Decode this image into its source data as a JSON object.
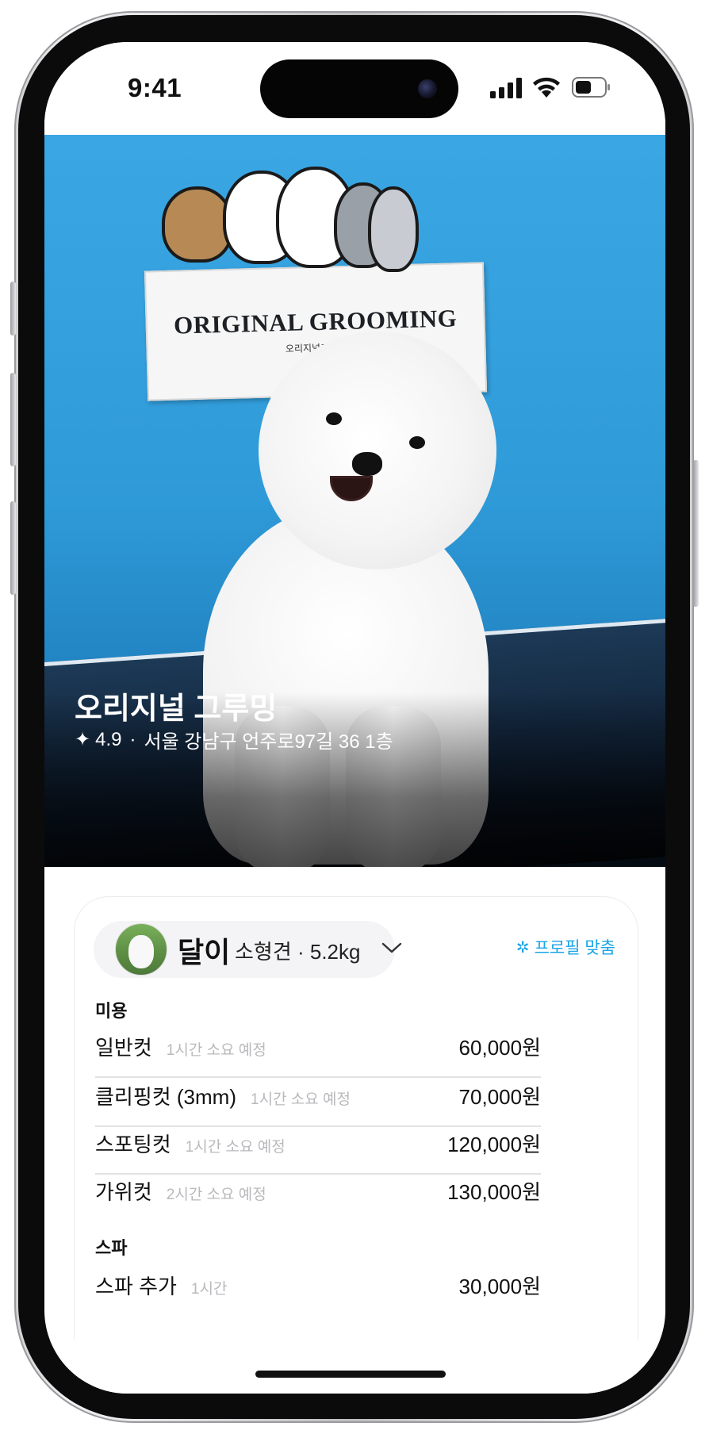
{
  "status_bar": {
    "time": "9:41"
  },
  "hero": {
    "sign_title": "ORIGINAL GROOMING",
    "sign_subtitle": "오리지널그루밍",
    "shop_name": "오리지널 그루밍",
    "rating_icon": "sparkle-icon",
    "rating": "4.9",
    "separator": "·",
    "address": "서울 강남구 언주로97길 36 1층"
  },
  "pet": {
    "name": "달이",
    "info": "소형견 · 5.2kg",
    "dropdown_icon": "chevron-down-icon"
  },
  "profile_link": {
    "icon": "asterisk-icon",
    "label": "프로필 맞춤"
  },
  "sections": [
    {
      "title": "미용",
      "items": [
        {
          "name": "일반컷",
          "duration": "1시간 소요 예정",
          "price": "60,000원"
        },
        {
          "name": "클리핑컷 (3mm)",
          "duration": "1시간 소요 예정",
          "price": "70,000원"
        },
        {
          "name": "스포팅컷",
          "duration": "1시간 소요 예정",
          "price": "120,000원"
        },
        {
          "name": "가위컷",
          "duration": "2시간 소요 예정",
          "price": "130,000원"
        }
      ]
    },
    {
      "title": "스파",
      "items": [
        {
          "name": "스파 추가",
          "duration": "1시간",
          "price": "30,000원"
        }
      ]
    }
  ],
  "colors": {
    "accent": "#1aa5e6",
    "hero_blue": "#3aa7e4"
  }
}
